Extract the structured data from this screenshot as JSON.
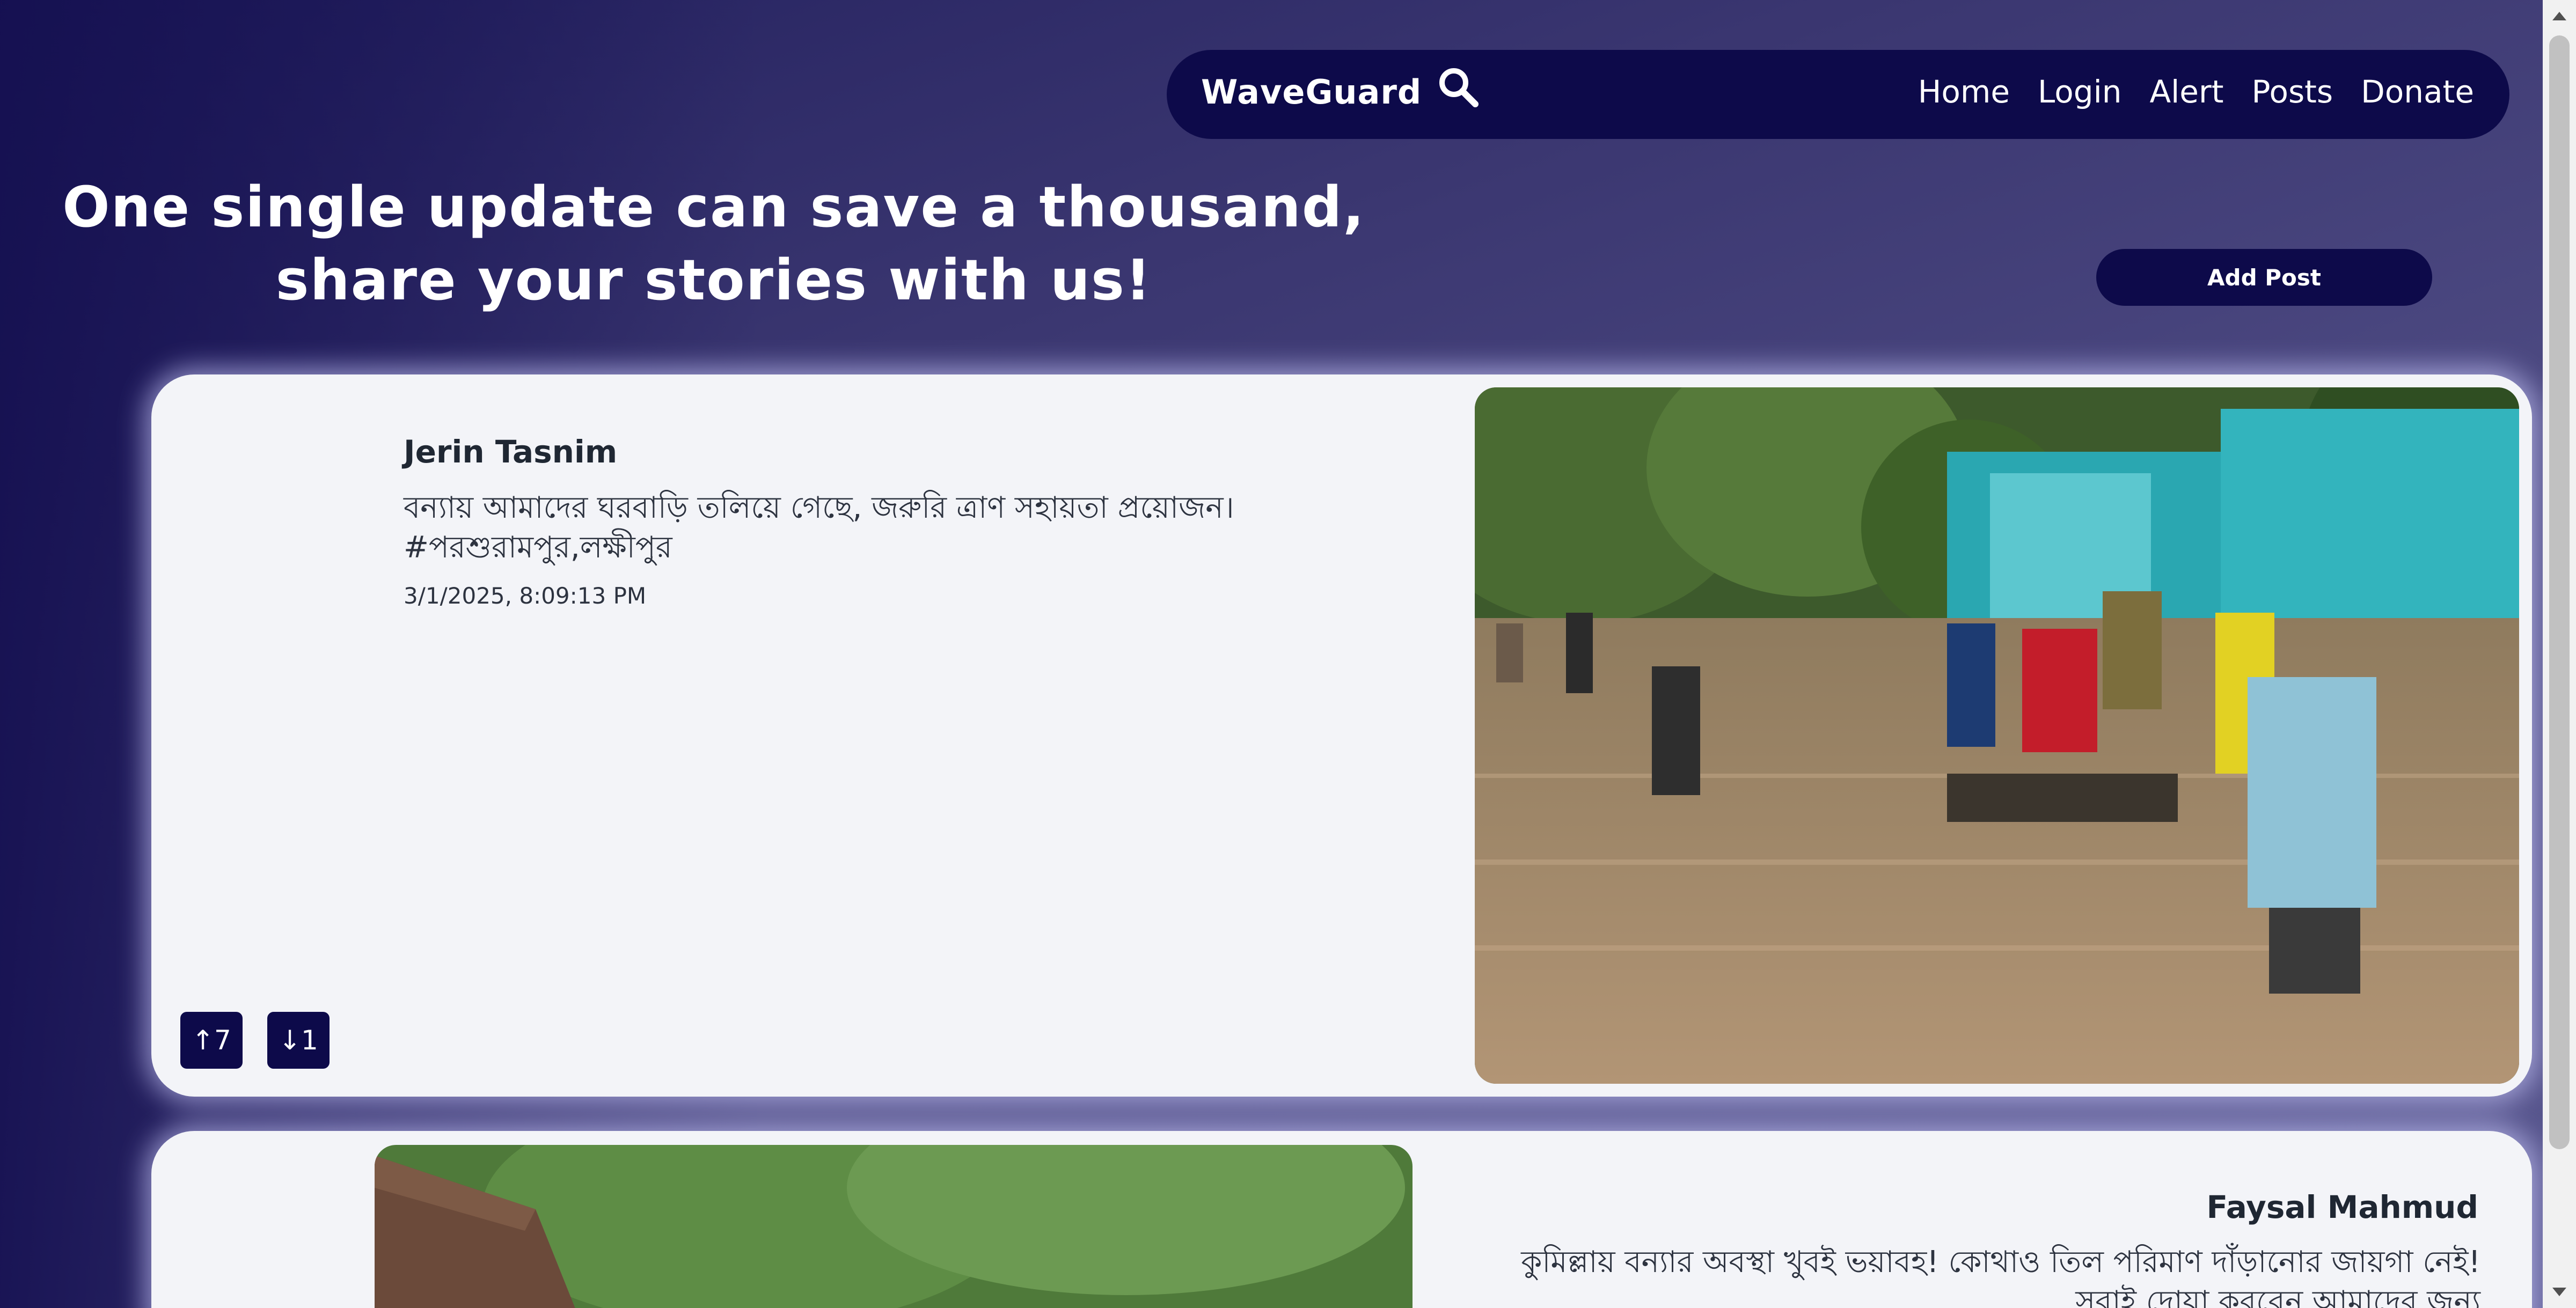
{
  "nav": {
    "brand": "WaveGuard",
    "links": [
      "Home",
      "Login",
      "Alert",
      "Posts",
      "Donate"
    ]
  },
  "hero": {
    "tagline": "One single update can save a thousand, share your stories with us!",
    "add_post_label": "Add Post"
  },
  "posts": [
    {
      "author": "Jerin Tasnim",
      "content": "বন্যায় আমাদের ঘরবাড়ি তলিয়ে গেছে, জরুরি ত্রাণ সহায়তা প্রয়োজন।\n#পরশুরামপুর,লক্ষীপুর",
      "timestamp": "3/1/2025, 8:09:13 PM",
      "upvotes": "7",
      "downvotes": "1"
    },
    {
      "author": "Faysal Mahmud",
      "content": "কুমিল্লায় বন্যার অবস্থা খুবই ভয়াবহ! কোথাও তিল পরিমাণ দাঁড়ানোর জায়গা নেই! সবাই দোয়া করবেন আমাদের জন্য"
    }
  ],
  "colors": {
    "nav_bg": "#0d0a4a",
    "card_bg": "#f3f4f8",
    "water": "#a98c66"
  }
}
